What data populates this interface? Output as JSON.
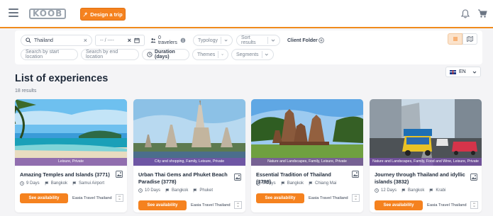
{
  "header": {
    "logo_text": "KOOB",
    "design_button": "Design a trip"
  },
  "filters": {
    "destination_value": "Thailand",
    "date_from_placeholder": "-- / ----",
    "travelers": "0 travelers",
    "typology": "Typology",
    "sort": "Sort results",
    "client_folder": "Client Folder",
    "start_location_placeholder": "Search by start location",
    "end_location_placeholder": "Search by end location",
    "duration": "Duration (days)",
    "themes": "Themes",
    "segments": "Segments"
  },
  "main": {
    "title": "List of experiences",
    "results": "18 results",
    "language": "EN"
  },
  "cards": [
    {
      "tags": "Leisure, Private",
      "title": "Amazing Temples and Islands (3771)",
      "days": "9 Days",
      "start": "Bangkok",
      "end": "Samui Airport",
      "button": "See availability",
      "agency": "Easia Travel Thailand"
    },
    {
      "tags": "City and shopping, Family, Leisure, Private",
      "title": "Urban Thai Gems and Phuket Beach Paradise (3778)",
      "days": "10 Days",
      "start": "Bangkok",
      "end": "Phuket",
      "button": "See availability",
      "agency": "Easia Travel Thailand"
    },
    {
      "tags": "Nature and Landscapes, Family, Leisure, Private",
      "title": "Essential Tradition of Thailand (3789)",
      "days": "9 Days",
      "start": "Bangkok",
      "end": "Chiang Mai",
      "button": "See availability",
      "agency": "Easia Travel Thailand"
    },
    {
      "tags": "Nature and Landscapes, Family, Food and Wine, Leisure, Private",
      "title": "Journey through Thailand and idyllic islands (3832)",
      "days": "12 Days",
      "start": "Bangkok",
      "end": "Krabi",
      "button": "See availability",
      "agency": "Easia Travel Thailand"
    }
  ],
  "colors": {
    "accent": "#f5821f",
    "tag_band": "#7850aa"
  }
}
